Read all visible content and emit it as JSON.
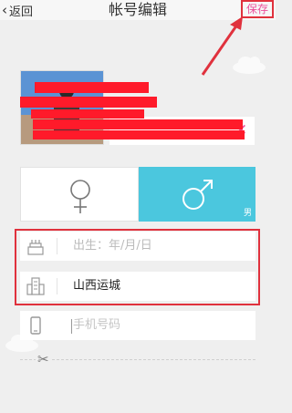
{
  "header": {
    "back_label": "返回",
    "title": "帐号编辑",
    "save_label": "保存"
  },
  "gender": {
    "selected": "male",
    "male_tag": "男"
  },
  "form": {
    "birthday_placeholder": "出生：年/月/日",
    "city_value": "山西运城",
    "phone_placeholder": "手机号码"
  },
  "colors": {
    "accent_pink": "#ec4f9b",
    "annotation_red": "#e0313d",
    "male_selected_bg": "#4bc7de",
    "background": "#efefef"
  },
  "icons": [
    "chevron-left-icon",
    "clear-icon",
    "female-icon",
    "male-icon",
    "cake-icon",
    "building-icon",
    "phone-icon",
    "scissors-icon"
  ]
}
